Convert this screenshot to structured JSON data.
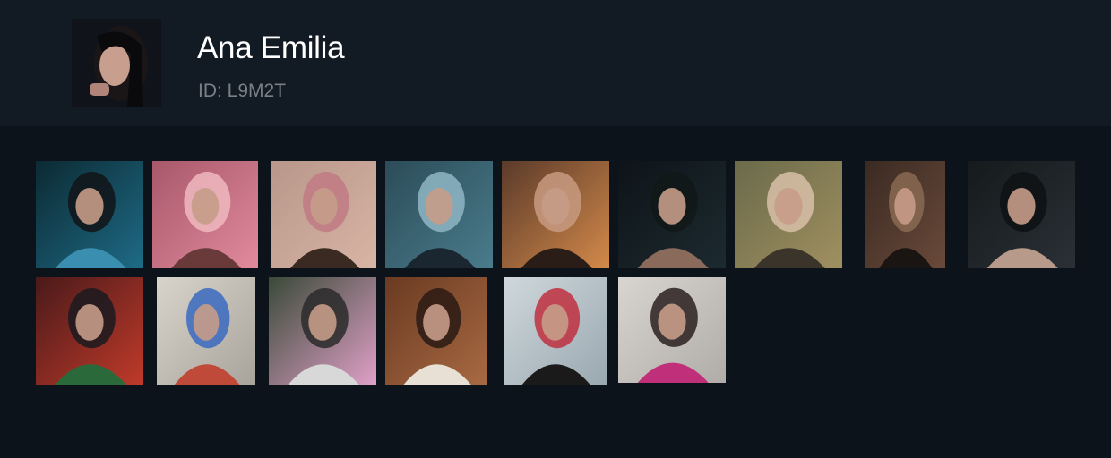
{
  "profile": {
    "name": "Ana Emilia",
    "id_label": "ID: L9M2T",
    "avatar_icon": "profile-photo",
    "colors": {
      "background": "#0d131b",
      "header": "#121a23",
      "name": "#ffffff",
      "id": "#7b8087"
    }
  },
  "gallery": {
    "items": [
      {
        "thumb": "thumb-01",
        "palette": [
          "#0c2a33",
          "#1e6b86",
          "#3a8fb0",
          "#101418"
        ]
      },
      {
        "thumb": "thumb-02",
        "palette": [
          "#a8586a",
          "#e28a9e",
          "#6a3a3a",
          "#f0b8c0"
        ]
      },
      {
        "thumb": "thumb-03",
        "palette": [
          "#b8978a",
          "#d8b4a4",
          "#3a2a22",
          "#c07a84"
        ]
      },
      {
        "thumb": "thumb-04",
        "palette": [
          "#2c4c58",
          "#4a7c8c",
          "#1a2630",
          "#8fb6c4"
        ]
      },
      {
        "thumb": "thumb-05",
        "palette": [
          "#5a3a2a",
          "#d48a4a",
          "#2a1c16",
          "#c89a80"
        ]
      },
      {
        "thumb": "thumb-06",
        "palette": [
          "#0e1418",
          "#1c2a30",
          "#8a6a5a",
          "#101818"
        ]
      },
      {
        "thumb": "thumb-07",
        "palette": [
          "#6a6a4a",
          "#a09060",
          "#3a342a",
          "#d8c0a8"
        ]
      },
      {
        "thumb": "thumb-08",
        "palette": [
          "#3a2a22",
          "#6a4a3a",
          "#1a1412",
          "#8a6a52"
        ]
      },
      {
        "thumb": "thumb-09",
        "palette": [
          "#161a1c",
          "#2a3036",
          "#b89a8a",
          "#0e1214"
        ]
      },
      {
        "thumb": "thumb-10",
        "palette": [
          "#4a1a1a",
          "#c03a2a",
          "#2a6a3a",
          "#1a1a20"
        ]
      },
      {
        "thumb": "thumb-11",
        "palette": [
          "#d8d4cc",
          "#a8a49c",
          "#c04a3a",
          "#3a6ac0"
        ]
      },
      {
        "thumb": "thumb-12",
        "palette": [
          "#3a4a38",
          "#e0a0c8",
          "#d8d8d8",
          "#2a2a2a"
        ]
      },
      {
        "thumb": "thumb-13",
        "palette": [
          "#6a3a22",
          "#a86a42",
          "#e8e0d4",
          "#2a1a14"
        ]
      },
      {
        "thumb": "thumb-14",
        "palette": [
          "#cfd8dc",
          "#9aa8b0",
          "#1a1a1a",
          "#c03040"
        ]
      },
      {
        "thumb": "thumb-15",
        "palette": [
          "#d8d4d0",
          "#b0aca8",
          "#c0307a",
          "#2a2020"
        ]
      }
    ]
  }
}
